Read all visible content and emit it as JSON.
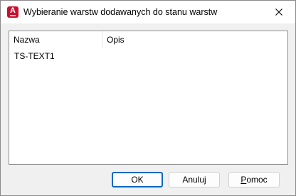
{
  "window": {
    "title": "Wybieranie warstw dodawanych do stanu warstw",
    "app_icon": "autocad-icon",
    "close_icon": "close-icon"
  },
  "list": {
    "columns": [
      "Nazwa",
      "Opis"
    ],
    "rows": [
      {
        "name": "TS-TEXT1",
        "description": ""
      }
    ]
  },
  "buttons": {
    "ok_label": "OK",
    "cancel_label": "Anuluj",
    "help_label_hot": "P",
    "help_label_rest": "omoc"
  },
  "colors": {
    "app_icon": "#c8102e",
    "default_button_border": "#0067c0"
  }
}
